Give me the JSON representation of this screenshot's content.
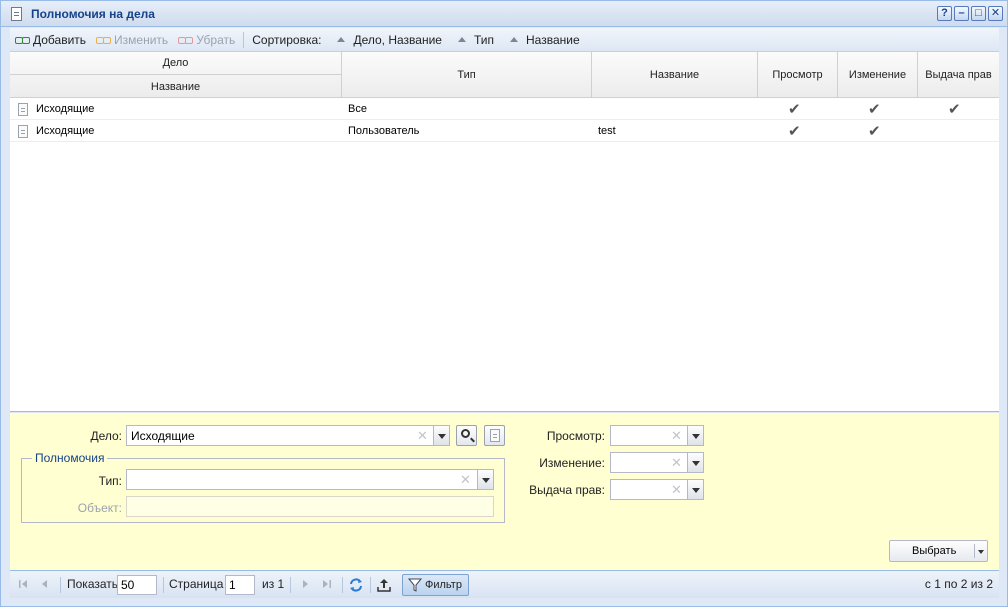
{
  "window": {
    "title": "Полномочия на дела",
    "buttons": {
      "help": "?",
      "minimize": "–",
      "maximize": "□",
      "close": "✕"
    }
  },
  "toolbar": {
    "add_label": "Добавить",
    "edit_label": "Изменить",
    "remove_label": "Убрать",
    "sort_label": "Сортировка:",
    "sort_items": [
      "Дело, Название",
      "Тип",
      "Название"
    ]
  },
  "grid": {
    "group_header": "Дело",
    "columns": [
      "Название",
      "Тип",
      "Название",
      "Просмотр",
      "Изменение",
      "Выдача прав"
    ],
    "rows": [
      {
        "delo": "Исходящие",
        "type": "Все",
        "name": "",
        "view": "✔",
        "edit": "✔",
        "grant": "✔"
      },
      {
        "delo": "Исходящие",
        "type": "Пользователь",
        "name": "test",
        "view": "✔",
        "edit": "✔",
        "grant": ""
      }
    ]
  },
  "form": {
    "delo_label": "Дело:",
    "delo_value": "Исходящие",
    "fieldset_legend": "Полномочия",
    "type_label": "Тип:",
    "type_value": "",
    "object_label": "Объект:",
    "object_value": "",
    "view_label": "Просмотр:",
    "edit_label": "Изменение:",
    "grant_label": "Выдача прав:",
    "clear_glyph": "✕",
    "pick_label": "Выбрать"
  },
  "pager": {
    "show_label": "Показать",
    "page_size": "50",
    "page_label": "Страница",
    "page": "1",
    "of_label": "из 1",
    "filter_label": "Фильтр",
    "summary": "с 1 по 2 из 2"
  },
  "colors": {
    "title": "#15428b",
    "form_bg": "#ffffd2",
    "border": "#99bbe8"
  }
}
